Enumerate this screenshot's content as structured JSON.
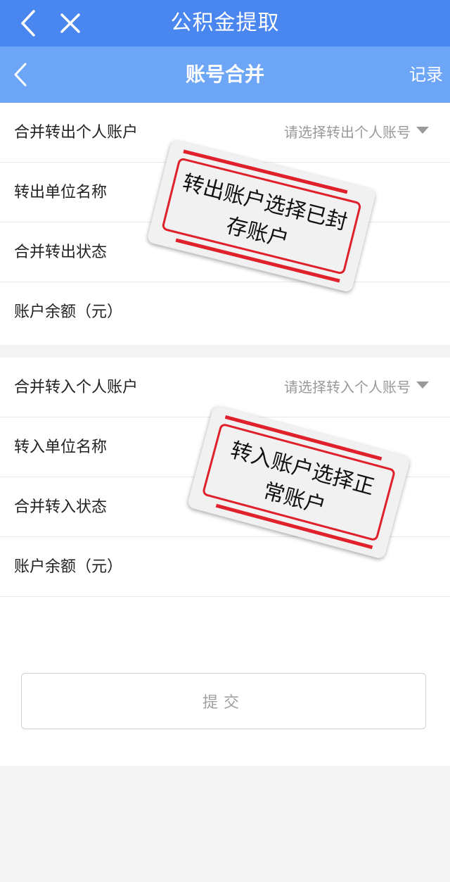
{
  "topbar": {
    "title": "公积金提取",
    "icons": {
      "back": "back-chevron-icon",
      "close": "close-icon"
    }
  },
  "subbar": {
    "title": "账号合并",
    "record_label": "记录",
    "icons": {
      "back": "back-chevron-icon"
    }
  },
  "transfer_out": {
    "rows": [
      {
        "label": "合并转出个人账户",
        "value": "请选择转出个人账号"
      },
      {
        "label": "转出单位名称",
        "value": ""
      },
      {
        "label": "合并转出状态",
        "value": ""
      },
      {
        "label": "账户余额（元）",
        "value": ""
      }
    ],
    "annotation": "转出账户选择已封存账户"
  },
  "transfer_in": {
    "rows": [
      {
        "label": "合并转入个人账户",
        "value": "请选择转入个人账号"
      },
      {
        "label": "转入单位名称",
        "value": ""
      },
      {
        "label": "合并转入状态",
        "value": ""
      },
      {
        "label": "账户余额（元）",
        "value": ""
      }
    ],
    "annotation": "转入账户选择正常账户"
  },
  "submit_label": "提交",
  "colors": {
    "topbar": "#4a86f0",
    "subbar": "#6ea6f7",
    "annotation_red": "#e0202a"
  }
}
